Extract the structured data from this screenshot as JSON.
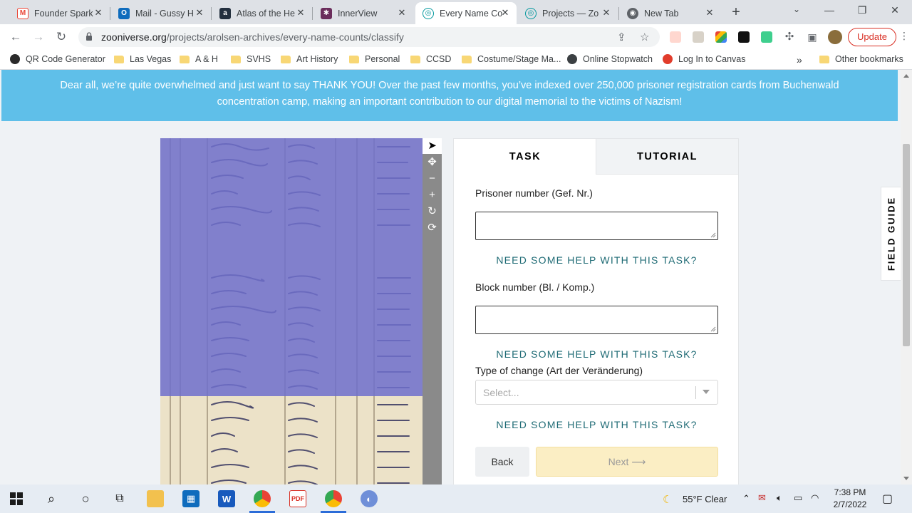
{
  "browser": {
    "tabs": [
      {
        "label": "Founder Spark",
        "icon": "gmail-icon",
        "color": "#ea4335",
        "glyph": "M"
      },
      {
        "label": "Mail - Gussy H",
        "icon": "outlook-icon",
        "color": "#0f6cbd",
        "glyph": "O"
      },
      {
        "label": "Atlas of the He",
        "icon": "amazon-icon",
        "color": "#232f3e",
        "glyph": "a"
      },
      {
        "label": "InnerView",
        "icon": "innerview-icon",
        "color": "#6b2d5c",
        "glyph": "✱"
      },
      {
        "label": "Every Name Co",
        "icon": "zooniverse-icon",
        "color": "#00979d",
        "glyph": "◎"
      },
      {
        "label": "Projects — Zo",
        "icon": "zooniverse-icon",
        "color": "#00979d",
        "glyph": "◎"
      },
      {
        "label": "New Tab",
        "icon": "chrome-icon",
        "color": "#5f6368",
        "glyph": "◉"
      }
    ],
    "active_tab": 4,
    "url_host": "zooniverse.org",
    "url_path": "/projects/arolsen-archives/every-name-counts/classify",
    "update_label": "Update"
  },
  "bookmarks": [
    {
      "label": "QR Code Generator",
      "type": "circle",
      "color": "#2a2a2a"
    },
    {
      "label": "Las Vegas",
      "type": "folder"
    },
    {
      "label": "A & H",
      "type": "folder"
    },
    {
      "label": "SVHS",
      "type": "folder"
    },
    {
      "label": "Art History",
      "type": "folder"
    },
    {
      "label": "Personal",
      "type": "folder"
    },
    {
      "label": "CCSD",
      "type": "folder"
    },
    {
      "label": "Costume/Stage Ma...",
      "type": "folder"
    },
    {
      "label": "Online Stopwatch",
      "type": "circle",
      "color": "#3c4043"
    },
    {
      "label": "Log In to Canvas",
      "type": "circle",
      "color": "#e13c2b"
    }
  ],
  "other_bookmarks": "Other bookmarks",
  "banner": {
    "line1": "Dear all, we’re quite overwhelmed and just want to say THANK YOU! Over the past few months, you’ve indexed over 250,000 prisoner registration cards from Buchenwald",
    "line2": "concentration camp, making an important contribution to our digital memorial to the victims of Nazism!"
  },
  "task": {
    "tab_task": "TASK",
    "tab_tutorial": "TUTORIAL",
    "q1_label": "Prisoner number (Gef. Nr.)",
    "q1_value": "",
    "q2_label": "Block number (Bl. / Komp.)",
    "q2_value": "",
    "help_label": "NEED SOME HELP WITH THIS TASK?",
    "q3_label": "Type of change (Art der Veränderung)",
    "q3_placeholder": "Select...",
    "back_label": "Back",
    "next_label": "Next ⟶"
  },
  "field_guide_label": "FIELD GUIDE",
  "tray": {
    "weather": "55°F  Clear",
    "time": "7:38 PM",
    "date": "2/7/2022"
  }
}
